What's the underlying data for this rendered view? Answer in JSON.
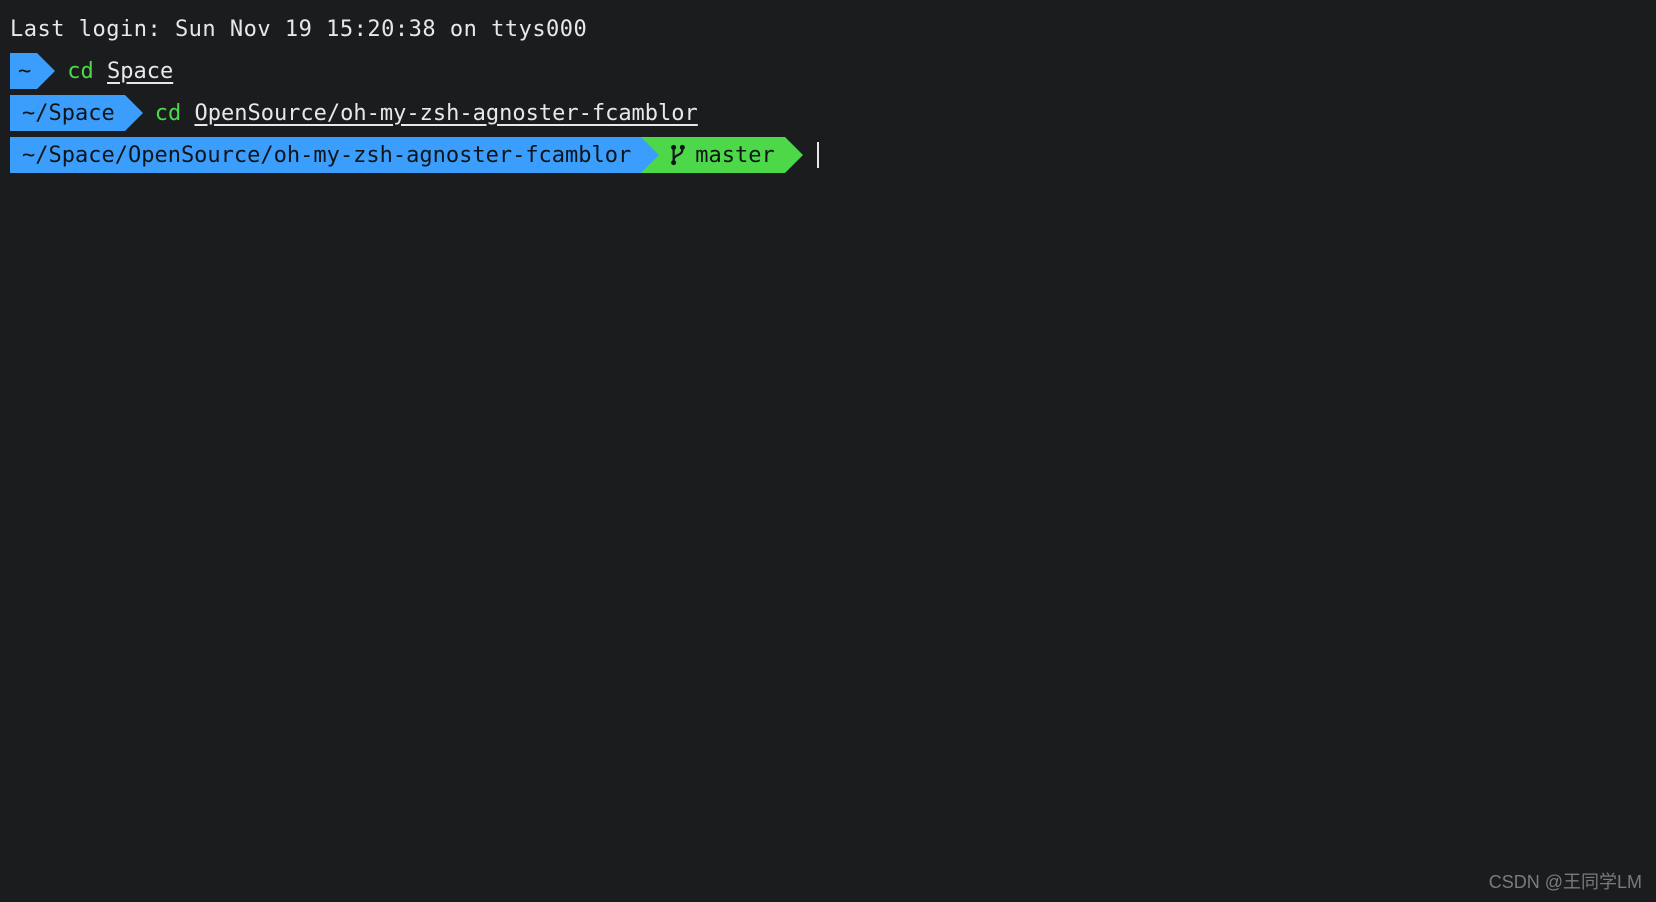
{
  "login_message": "Last login: Sun Nov 19 15:20:38 on ttys000",
  "prompt1": {
    "path": "~",
    "cmd": "cd",
    "arg": "Space"
  },
  "prompt2": {
    "path": "~/Space",
    "cmd": "cd",
    "arg": "OpenSource/oh-my-zsh-agnoster-fcamblor"
  },
  "prompt3": {
    "path": "~/Space/OpenSource/oh-my-zsh-agnoster-fcamblor",
    "branch": "master"
  },
  "watermark": "CSDN @王同学LM",
  "colors": {
    "bg": "#1a1c1e",
    "blue": "#3b9efc",
    "green": "#4dd84a",
    "text": "#e8e8e8"
  }
}
